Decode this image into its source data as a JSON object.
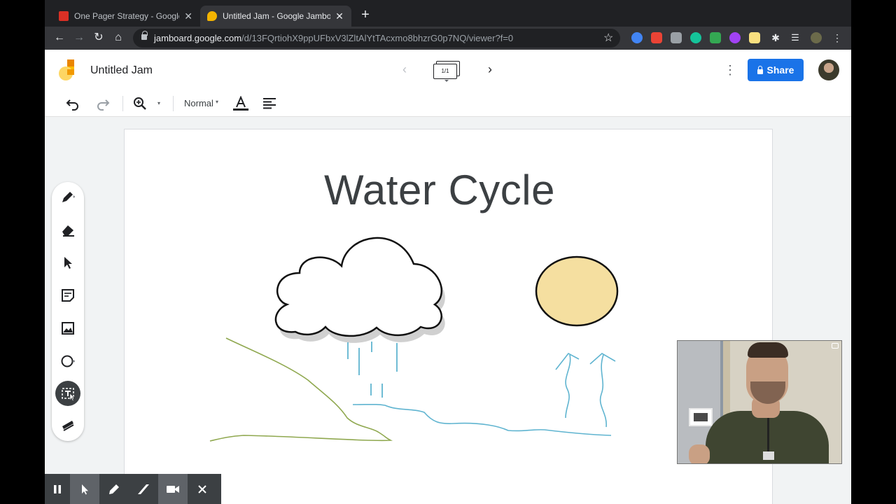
{
  "browser": {
    "tabs": [
      {
        "title": "One Pager Strategy - Google D",
        "favicon": "slides-icon",
        "color": "#d93025",
        "active": false
      },
      {
        "title": "Untitled Jam - Google Jamboa",
        "favicon": "jamboard-icon",
        "color": "#f4b400",
        "active": true
      }
    ],
    "new_tab_label": "+",
    "url_host": "jamboard.google.com",
    "url_path": "/d/13FQrtiohX9ppUFbxV3lZltAlYtTAcxmo8bhzrG0p7NQ/viewer?f=0",
    "extensions": [
      "camera-ext-icon",
      "clip-ext-icon",
      "mail-ext-icon",
      "grammarly-icon",
      "green-ext-icon",
      "purple-ext-icon",
      "notes-ext-icon",
      "puzzle-icon",
      "playlist-icon",
      "profile-icon",
      "kebab-icon"
    ]
  },
  "app": {
    "doc_title": "Untitled Jam",
    "frame_counter": "1/1",
    "share_label": "Share",
    "accent_color": "#1a73e8"
  },
  "toolbar": {
    "font_size": "Normal",
    "font_size_caret": "▾",
    "zoom_caret": "▾"
  },
  "board": {
    "title": "Water Cycle",
    "sun_color": "#f5dfa0",
    "land_color": "#8fa84f",
    "water_color": "#5fb4d0"
  },
  "tools": [
    "pen-icon",
    "eraser-icon",
    "select-arrow-icon",
    "sticky-note-icon",
    "image-icon",
    "circle-shape-icon",
    "text-box-icon",
    "laser-icon"
  ],
  "recorder": [
    "pause-icon",
    "cursor-icon",
    "pen-icon",
    "highlighter-icon",
    "camera-icon",
    "close-icon"
  ]
}
